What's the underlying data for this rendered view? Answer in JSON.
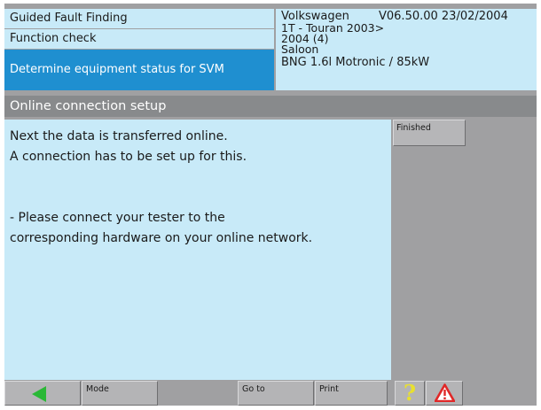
{
  "header": {
    "items": [
      "Guided Fault Finding",
      "Function check",
      "Determine equipment status for SVM"
    ],
    "active_index": 2
  },
  "vehicle": {
    "make": "Volkswagen",
    "version": "V06.50.00 23/02/2004",
    "model": "1T - Touran 2003>",
    "year": "2004 (4)",
    "body": "Saloon",
    "engine": "BNG 1.6l Motronic / 85kW"
  },
  "title": "Online connection setup",
  "message": {
    "line1": "Next the data is transferred online.",
    "line2": "A connection has to be set up for this.",
    "line3": "- Please connect your tester to the",
    "line4": "corresponding hardware on your online network."
  },
  "side": {
    "finished_label": "Finished"
  },
  "toolbar": {
    "mode_label": "Mode",
    "goto_label": "Go to",
    "print_label": "Print",
    "help_glyph": "?"
  },
  "colors": {
    "panel_light_blue": "#c8eaf8",
    "active_blue": "#1f8fd0",
    "title_gray": "#888a8c",
    "background_gray": "#a0a0a2",
    "back_arrow_green": "#2ab836",
    "help_yellow": "#e8e030",
    "warning_red": "#e02828"
  },
  "icons": {
    "back": "back-arrow-icon",
    "help": "help-icon",
    "warning": "warning-icon"
  }
}
